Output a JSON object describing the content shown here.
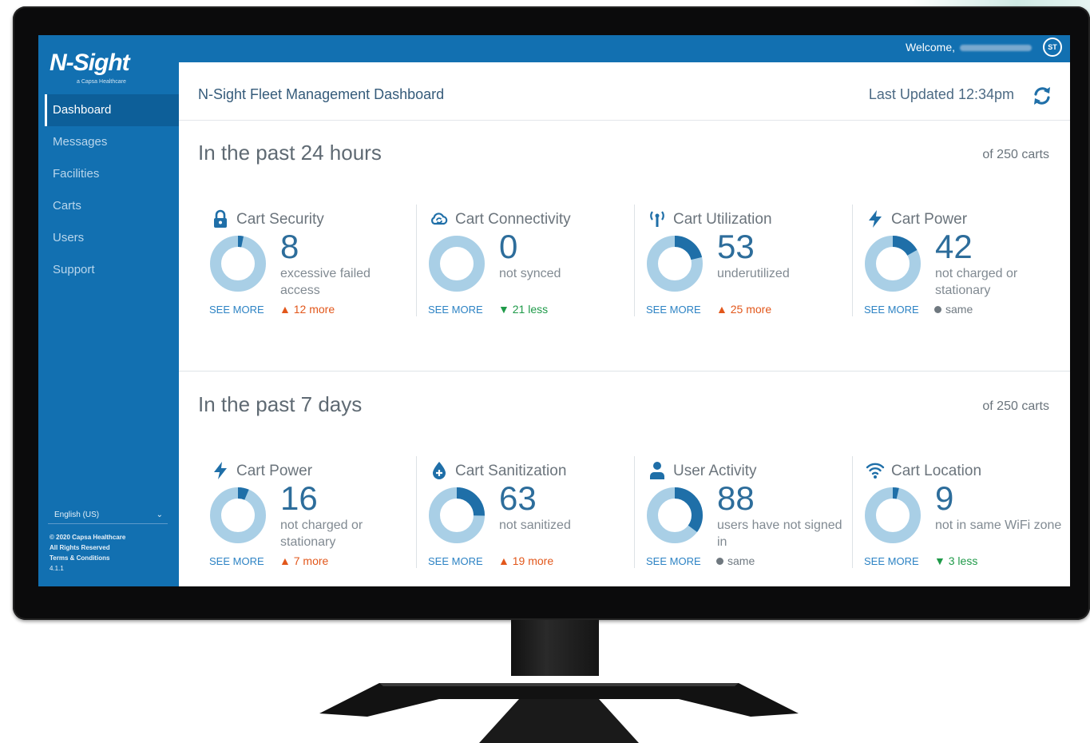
{
  "app": {
    "logo_text": "N-Sight",
    "logo_sub": "a Capsa Healthcare"
  },
  "sidebar": {
    "items": [
      {
        "label": "Dashboard",
        "active": true
      },
      {
        "label": "Messages"
      },
      {
        "label": "Facilities"
      },
      {
        "label": "Carts"
      },
      {
        "label": "Users"
      },
      {
        "label": "Support"
      }
    ],
    "language": "English (US)",
    "footer": {
      "copyright": "© 2020 Capsa Healthcare",
      "rights": "All Rights Reserved",
      "terms": "Terms & Conditions",
      "version": "4.1.1"
    }
  },
  "topbar": {
    "welcome": "Welcome,",
    "avatar_initials": "ST"
  },
  "header": {
    "title": "N-Sight Fleet Management Dashboard",
    "last_updated": "Last Updated 12:34pm"
  },
  "sections": [
    {
      "title": "In the past 24 hours",
      "of_carts": "of 250 carts",
      "cards": [
        {
          "title": "Cart Security",
          "icon": "lock-icon",
          "value": "8",
          "description": "excessive failed access",
          "see_more": "SEE MORE",
          "change": "12 more",
          "trend": "up",
          "ring_fraction": 0.032
        },
        {
          "title": "Cart Connectivity",
          "icon": "cloud-sync-icon",
          "value": "0",
          "description": "not synced",
          "see_more": "SEE MORE",
          "change": "21 less",
          "trend": "down",
          "ring_fraction": 0
        },
        {
          "title": "Cart Utilization",
          "icon": "antenna-icon",
          "value": "53",
          "description": "underutilized",
          "see_more": "SEE MORE",
          "change": "25 more",
          "trend": "up",
          "ring_fraction": 0.212
        },
        {
          "title": "Cart Power",
          "icon": "bolt-icon",
          "value": "42",
          "description": "not charged or stationary",
          "see_more": "SEE MORE",
          "change": "same",
          "trend": "same",
          "ring_fraction": 0.168
        }
      ]
    },
    {
      "title": "In the past 7 days",
      "of_carts": "of 250 carts",
      "cards": [
        {
          "title": "Cart Power",
          "icon": "bolt-icon",
          "value": "16",
          "description": "not charged or stationary",
          "see_more": "SEE MORE",
          "change": "7 more",
          "trend": "up",
          "ring_fraction": 0.064
        },
        {
          "title": "Cart Sanitization",
          "icon": "droplet-plus-icon",
          "value": "63",
          "description": "not sanitized",
          "see_more": "SEE MORE",
          "change": "19 more",
          "trend": "up",
          "ring_fraction": 0.252
        },
        {
          "title": "User Activity",
          "icon": "user-icon",
          "value": "88",
          "description": "users have not signed in",
          "see_more": "SEE MORE",
          "change": "same",
          "trend": "same",
          "ring_fraction": 0.352
        },
        {
          "title": "Cart Location",
          "icon": "wifi-icon",
          "value": "9",
          "description": "not in same WiFi zone",
          "see_more": "SEE MORE",
          "change": "3 less",
          "trend": "down",
          "ring_fraction": 0.036
        }
      ]
    }
  ],
  "colors": {
    "brand_blue": "#1270b1",
    "ring_track": "#a9cfe6",
    "ring_fill": "#1f6fa8",
    "up": "#e2571b",
    "down": "#1f9a49",
    "same": "#707a82"
  }
}
